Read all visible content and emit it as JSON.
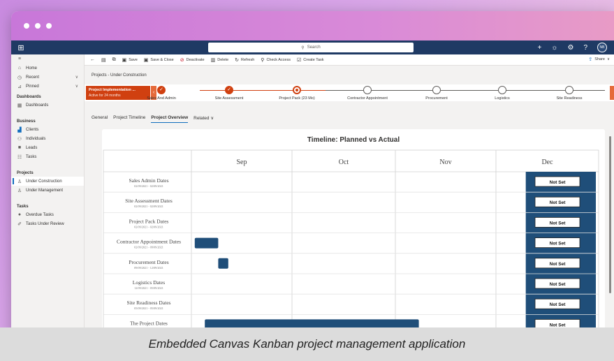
{
  "topnav": {
    "search_placeholder": "Search",
    "avatar_initials": "NB"
  },
  "sidebar": {
    "items_top": [
      {
        "icon": "home-icon",
        "glyph": "⌂",
        "label": "Home"
      },
      {
        "icon": "clock-icon",
        "glyph": "◷",
        "label": "Recent"
      },
      {
        "icon": "pin-icon",
        "glyph": "✎",
        "label": "Pinned"
      }
    ],
    "dashboards_head": "Dashboards",
    "dashboards_item": "Dashboards",
    "business_head": "Business",
    "business_items": [
      "Clients",
      "Individuals",
      "Leads",
      "Tasks"
    ],
    "projects_head": "Projects",
    "projects_items": [
      "Under Construction",
      "Under Management"
    ],
    "tasks_head": "Tasks",
    "tasks_items": [
      "Overdue Tasks",
      "Tasks Under Review"
    ]
  },
  "commandbar": {
    "save": "Save",
    "save_close": "Save & Close",
    "deactivate": "Deactivate",
    "delete": "Delete",
    "refresh": "Refresh",
    "check_access": "Check Access",
    "create_task": "Create Task",
    "share": "Share"
  },
  "breadcrumb": "Projects - Under Construction",
  "bpf": {
    "active_title": "Project Implementation ...",
    "active_sub": "Active for 24 months",
    "stages": [
      {
        "label": "Sales And Admin",
        "state": "done"
      },
      {
        "label": "Site Assessment",
        "state": "done"
      },
      {
        "label": "Project Pack  (23 Mo)",
        "state": "current"
      },
      {
        "label": "Contractor Appointment",
        "state": "todo"
      },
      {
        "label": "Procurement",
        "state": "todo"
      },
      {
        "label": "Logistics",
        "state": "todo"
      },
      {
        "label": "Site Readiness",
        "state": "todo"
      }
    ]
  },
  "tabs": [
    "General",
    "Project Timeline",
    "Project Overview",
    "Related"
  ],
  "chart_data": {
    "type": "timeline",
    "title": "Timeline: Planned vs Actual",
    "months": [
      "Sep",
      "Oct",
      "Nov",
      "Dec"
    ],
    "bar_color": "#1f4e79",
    "rows": [
      {
        "name": "Sales Admin Dates",
        "dates": "02/09/2021 - 02/09/2021",
        "badge": "Not Set",
        "bar": null
      },
      {
        "name": "Site Assessment Dates",
        "dates": "02/09/2021 - 02/09/2021",
        "badge": "Not Set",
        "bar": null
      },
      {
        "name": "Project Pack Dates",
        "dates": "02/09/2021 - 02/09/2021",
        "badge": "Not Set",
        "bar": null
      },
      {
        "name": "Contractor Appointment Dates",
        "dates": "02/09/2021 - 09/09/2021",
        "badge": "Not Set",
        "bar": {
          "start": "2021-09-02",
          "end": "2021-09-09"
        }
      },
      {
        "name": "Procurement Dates",
        "dates": "09/09/2021 - 12/09/2021",
        "badge": "Not Set",
        "bar": {
          "start": "2021-09-09",
          "end": "2021-09-12"
        }
      },
      {
        "name": "Logistics Dates",
        "dates": "12/09/2021 - 05/09/2021",
        "badge": "Not Set",
        "bar": null
      },
      {
        "name": "Site Readiness Dates",
        "dates": "05/09/2021 - 05/09/2021",
        "badge": "Not Set",
        "bar": null
      },
      {
        "name": "The Project Dates",
        "dates": "",
        "badge": "Not Set",
        "bar": {
          "start": "2021-09-05",
          "end": "2021-11-08"
        }
      }
    ],
    "dec_column_bar": {
      "start": "2021-12-10",
      "end": "2021-12-31"
    }
  },
  "caption": "Embedded Canvas Kanban project management application"
}
